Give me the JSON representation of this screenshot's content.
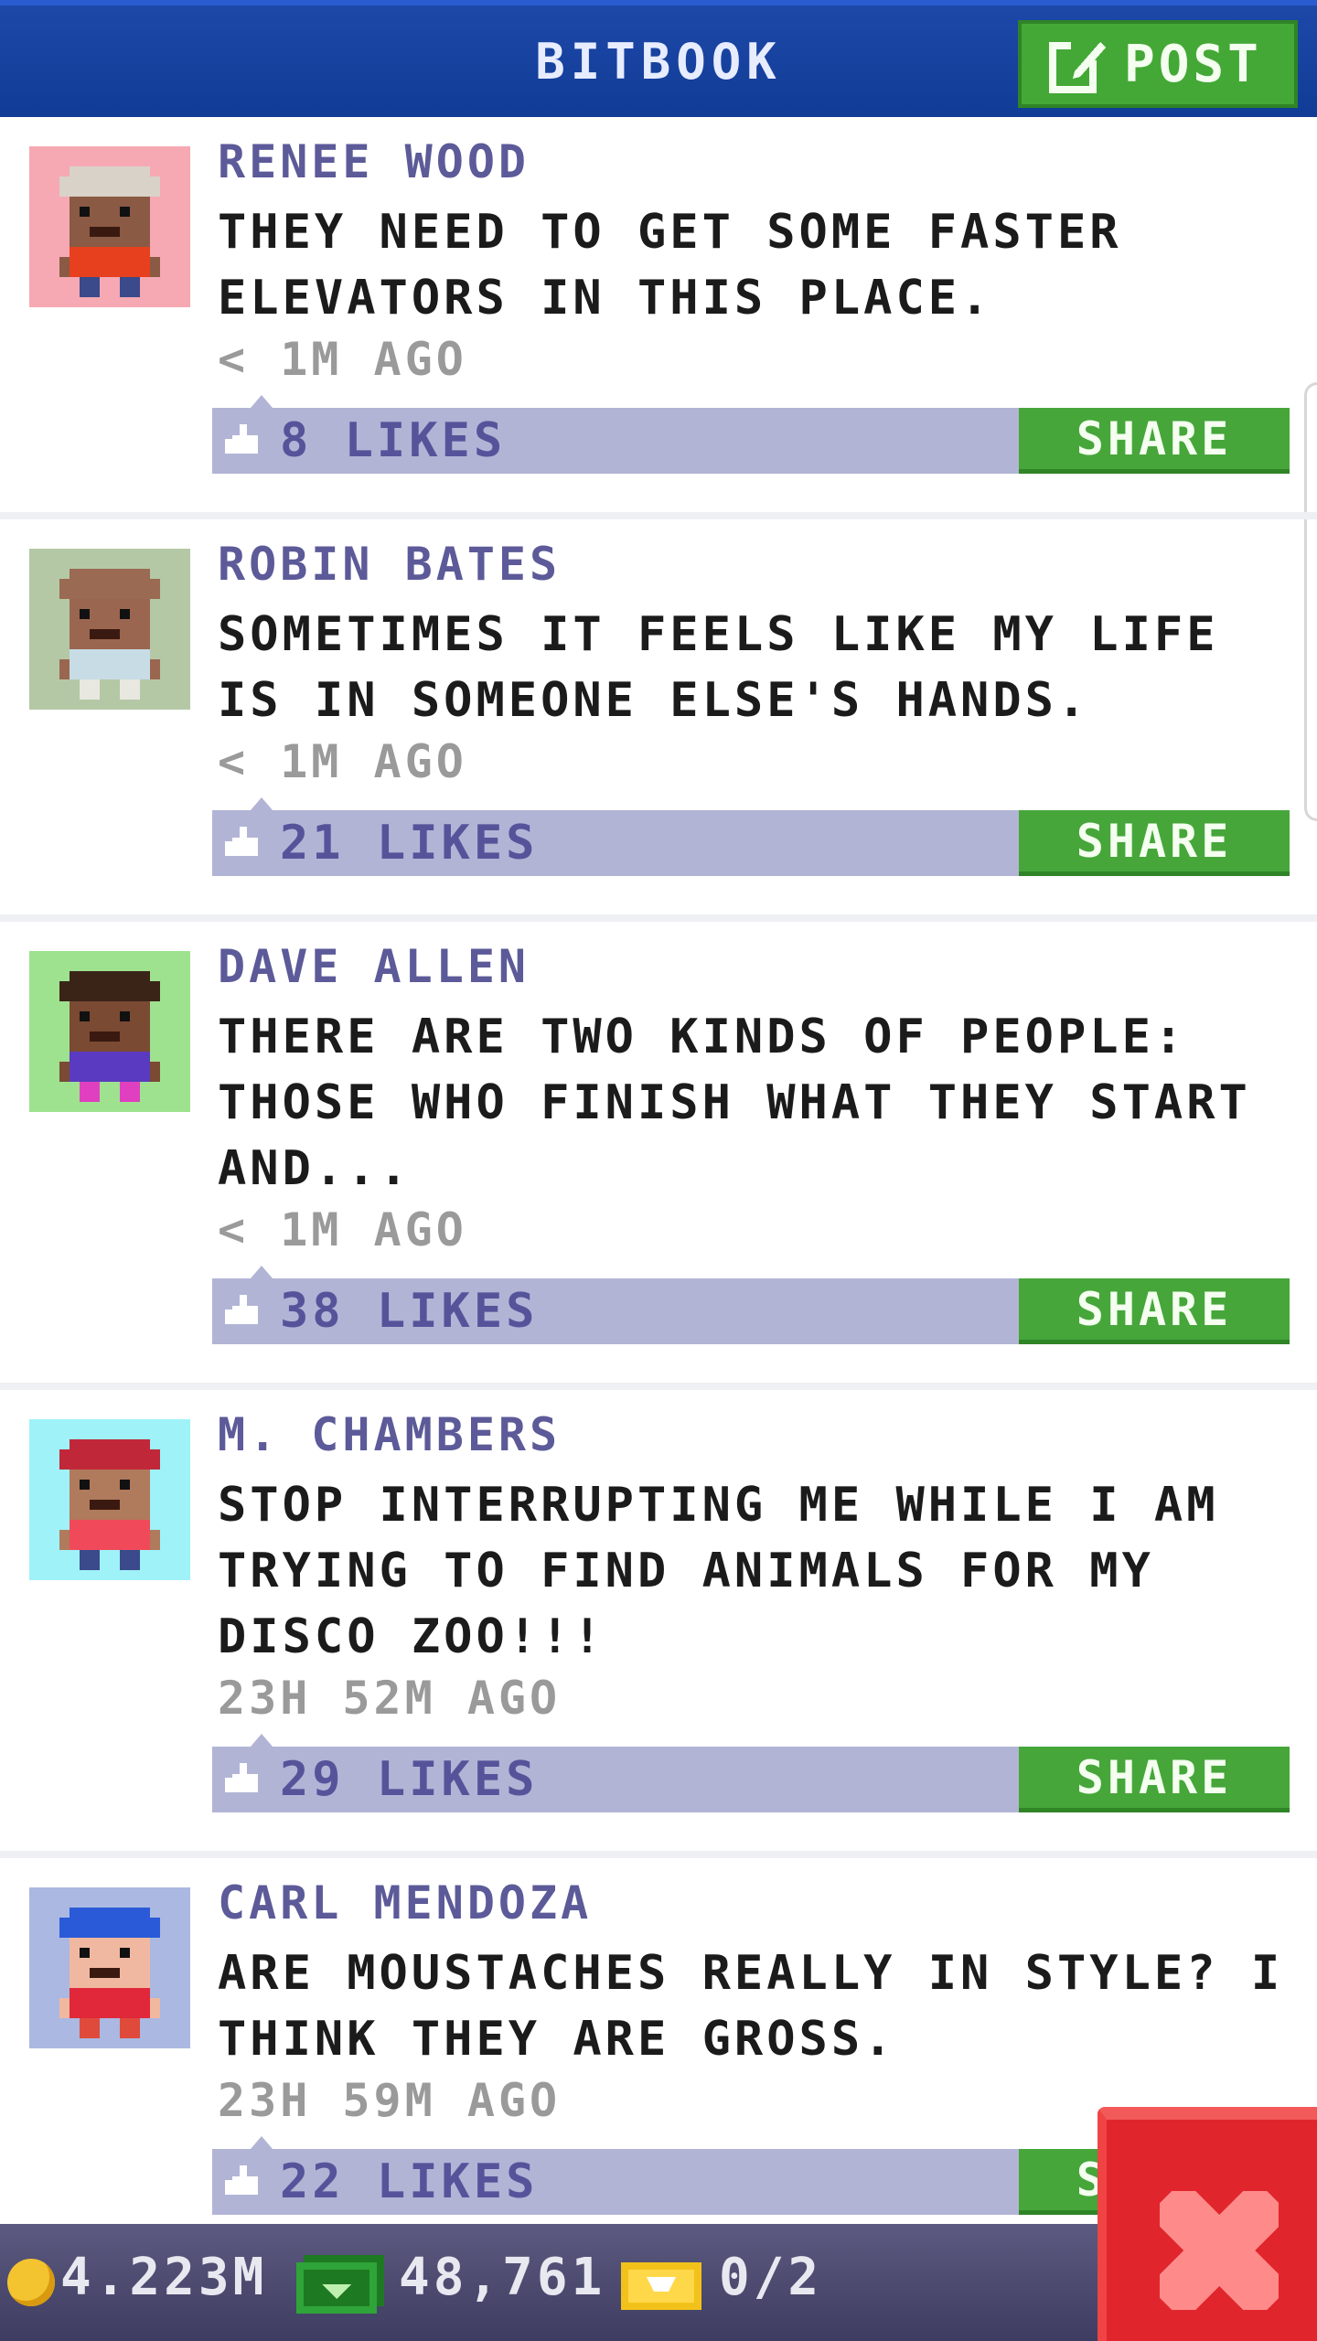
{
  "header": {
    "title": "BITBOOK",
    "post_label": "POST",
    "post_icon": "compose-icon",
    "bg_color": "#1e48a8"
  },
  "posts": [
    {
      "author": "RENEE WOOD",
      "message": "THEY NEED TO GET SOME FASTER ELEVATORS IN THIS PLACE.",
      "time": "< 1M AGO",
      "likes": "8 LIKES",
      "share": "SHARE",
      "avatar_bg": "#f6a9b3",
      "avatar_hair": "#d9d2c8",
      "avatar_shirt": "#e6401e",
      "avatar_skin": "#8a5a44",
      "avatar_pants": "#3a4a8a"
    },
    {
      "author": "ROBIN BATES",
      "message": "SOMETIMES IT FEELS LIKE MY LIFE IS IN SOMEONE ELSE'S HANDS.",
      "time": "< 1M AGO",
      "likes": "21 LIKES",
      "share": "SHARE",
      "avatar_bg": "#b4c8a6",
      "avatar_hair": "#9a6a52",
      "avatar_shirt": "#c8dce6",
      "avatar_skin": "#9a6650",
      "avatar_pants": "#e8e8e0"
    },
    {
      "author": "DAVE ALLEN",
      "message": "THERE ARE TWO KINDS OF PEOPLE: THOSE WHO FINISH WHAT THEY START AND...",
      "time": "< 1M AGO",
      "likes": "38 LIKES",
      "share": "SHARE",
      "avatar_bg": "#9ee28f",
      "avatar_hair": "#3a2418",
      "avatar_shirt": "#5a3ac0",
      "avatar_skin": "#7a4a32",
      "avatar_pants": "#e040c0"
    },
    {
      "author": "M. CHAMBERS",
      "message": "STOP INTERRUPTING ME WHILE I AM TRYING TO FIND ANIMALS FOR MY DISCO ZOO!!!",
      "time": "23H 52M AGO",
      "likes": "29 LIKES",
      "share": "SHARE",
      "avatar_bg": "#9ef2f8",
      "avatar_hair": "#c0283a",
      "avatar_shirt": "#f04a5a",
      "avatar_skin": "#b07a5c",
      "avatar_pants": "#3a4a8a"
    },
    {
      "author": "CARL MENDOZA",
      "message": "ARE MOUSTACHES REALLY IN STYLE? I THINK THEY ARE GROSS.",
      "time": "23H 59M AGO",
      "likes": "22 LIKES",
      "share": "SHARE",
      "avatar_bg": "#aab8e2",
      "avatar_hair": "#2a5ad8",
      "avatar_shirt": "#e0283a",
      "avatar_skin": "#f0b8a0",
      "avatar_pants": "#e04a3a"
    }
  ],
  "footer": {
    "coins": "4.223M",
    "bux": "48,761",
    "tickets": "0/2",
    "coin_icon": "coin-icon",
    "bux_icon": "bux-icon",
    "ticket_icon": "ticket-icon",
    "close_icon": "close-icon"
  }
}
